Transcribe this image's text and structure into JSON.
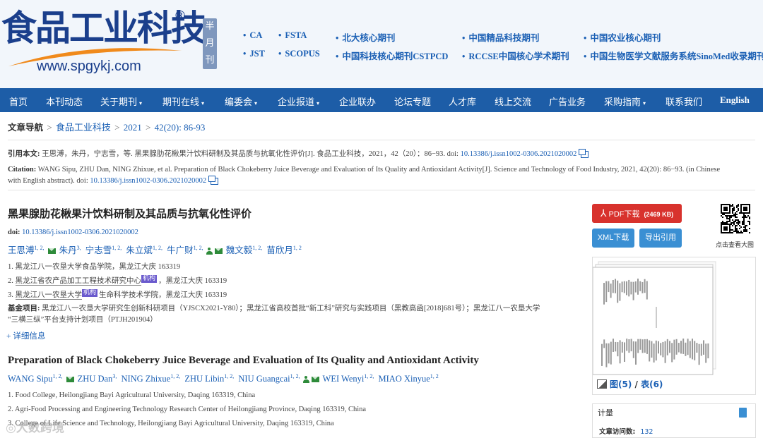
{
  "header": {
    "logo_text": "食品工业科技",
    "registered": "®",
    "site_url": "www.spgykj.com",
    "badge": "半月刊",
    "indexes": [
      {
        "label": "CA"
      },
      {
        "label": "FSTA"
      },
      {
        "label": "北大核心期刊"
      },
      {
        "label": "中国精品科技期刊"
      },
      {
        "label": "中国农业核心期刊"
      },
      {
        "label": "JST"
      },
      {
        "label": "SCOPUS"
      },
      {
        "label": "中国科技核心期刊CSTPCD"
      },
      {
        "label": "RCCSE中国核心学术期刊"
      },
      {
        "label": "中国生物医学文献服务系统SinoMed收录期刊"
      }
    ]
  },
  "nav": [
    "首页",
    "本刊动态",
    "关于期刊",
    "期刊在线",
    "编委会",
    "企业报道",
    "企业联办",
    "论坛专题",
    "人才库",
    "线上交流",
    "广告业务",
    "采购指南",
    "联系我们",
    "English"
  ],
  "nav_dropdown_caret": "▾",
  "breadcrumb": {
    "label": "文章导航",
    "sep": ">",
    "items": [
      "食品工业科技",
      "2021",
      "42(20): 86-93"
    ]
  },
  "citation": {
    "cn_label": "引用本文:",
    "cn_text": "王思溥，朱丹，宁志雪，等. 黑果腺肋花楸果汁饮料研制及其品质与抗氧化性评价[J]. 食品工业科技，2021，42（20）：86−93. doi: ",
    "cn_doi": "10.13386/j.issn1002-0306.2021020002",
    "en_label": "Citation:",
    "en_text1": "WANG Sipu, ZHU Dan, NING Zhixue, et al. Preparation of Black Chokeberry Juice Beverage and Evaluation of Its Quality and Antioxidant Activity[J]. Science and Technology of Food Industry, 2021, 42(20): 86−93. (in Chinese",
    "en_text2": "with English abstract). doi: ",
    "en_doi": "10.13386/j.issn1002-0306.2021020002"
  },
  "article": {
    "title_cn": "黑果腺肋花楸果汁饮料研制及其品质与抗氧化性评价",
    "doi_label": "doi:",
    "doi": "10.13386/j.issn1002-0306.2021020002",
    "authors_cn": [
      {
        "name": "王思溥",
        "sup": "1, 2,",
        "mail": true
      },
      {
        "name": "朱丹",
        "sup": "3,"
      },
      {
        "name": "宁志雪",
        "sup": "1, 2,"
      },
      {
        "name": "朱立斌",
        "sup": "1, 2,"
      },
      {
        "name": "牛广财",
        "sup": "1, 2,",
        "person": true,
        "mail": true
      },
      {
        "name": "魏文毅",
        "sup": "1, 2,"
      },
      {
        "name": "苗欣月",
        "sup": "1, 2"
      }
    ],
    "affiliations_cn": [
      {
        "num": "1.",
        "org": "",
        "text": "黑龙江八一农垦大学食品学院，黑龙江大庆 163319"
      },
      {
        "num": "2.",
        "org": "黑龙江省农产品加工工程技术研究中心",
        "tag": "机构",
        "text": "，黑龙江大庆 163319"
      },
      {
        "num": "3.",
        "org": "黑龙江八一农垦大学",
        "tag": "机构",
        "text": "生命科学技术学院，黑龙江大庆 163319"
      }
    ],
    "fund_label": "基金项目:",
    "fund_line1": "黑龙江八一农垦大学研究生创新科研项目（YJSCX2021-Y80）；黑龙江省高校首批“新工科”研究与实践项目（黑教高函[2018]681号）；黑龙江八一农垦大学",
    "fund_line2": "“三横三纵”平台支持计划项目（PTJH201904）",
    "more": "+ 详细信息",
    "title_en": "Preparation of Black Chokeberry Juice Beverage and Evaluation of Its Quality and Antioxidant Activity",
    "authors_en": [
      {
        "name": "WANG Sipu",
        "sup": "1, 2,",
        "mail": true
      },
      {
        "name": "ZHU Dan",
        "sup": "3,"
      },
      {
        "name": "NING Zhixue",
        "sup": "1, 2,"
      },
      {
        "name": "ZHU Libin",
        "sup": "1, 2,"
      },
      {
        "name": "NIU Guangcai",
        "sup": "1, 2,",
        "person": true,
        "mail": true
      },
      {
        "name": "WEI Wenyi",
        "sup": "1, 2,"
      },
      {
        "name": "MIAO Xinyue",
        "sup": "1, 2"
      }
    ],
    "affiliations_en": [
      "1.  Food College, Heilongjiang Bayi Agricultural University, Daqing 163319, China",
      "2.  Agri-Food Processing and Engineering Technology Research Center of Heilongjiang Province, Daqing 163319, China",
      "3.  College of Life Science and Technology, Heilongjiang Bayi Agricultural University, Daqing 163319, China"
    ]
  },
  "sidebar": {
    "pdf_label": "PDF下载",
    "pdf_size": "(2469 KB)",
    "xml_label": "XML下载",
    "export_label": "导出引用",
    "qr_label": "点击查看大图",
    "figures_label": "图(5)",
    "slash": " / ",
    "tables_label": "表(6)",
    "stats_title": "计量",
    "visits_label": "文章访问数:",
    "visits_value": "132"
  },
  "watermark": "◎大数跨境",
  "colors": {
    "nav_bg": "#1d5da7",
    "header_bg": "#f2f6fb",
    "link": "#1a5fb4",
    "pdf_btn": "#d8322d",
    "blue_btn": "#3a8fd3",
    "logo": "#1b3f8c",
    "swoosh": "#f08a1c"
  }
}
